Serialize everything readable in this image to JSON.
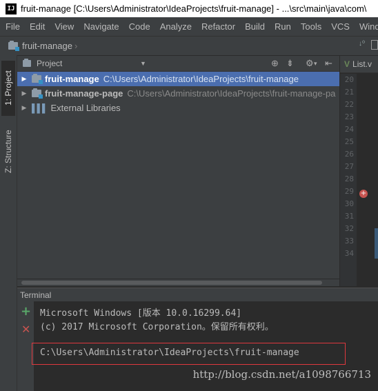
{
  "window": {
    "app_badge": "IJ",
    "title": "fruit-manage [C:\\Users\\Administrator\\IdeaProjects\\fruit-manage] - ...\\src\\main\\java\\com\\"
  },
  "menu": [
    "File",
    "Edit",
    "View",
    "Navigate",
    "Code",
    "Analyze",
    "Refactor",
    "Build",
    "Run",
    "Tools",
    "VCS",
    "Window"
  ],
  "navbar": {
    "breadcrumb": "fruit-manage"
  },
  "tool_strip": {
    "project_tab": "1: Project",
    "structure_tab": "Z: Structure"
  },
  "project_panel": {
    "header": "Project",
    "items": [
      {
        "name": "fruit-manage",
        "path": "C:\\Users\\Administrator\\IdeaProjects\\fruit-manage",
        "selected": true
      },
      {
        "name": "fruit-manage-page",
        "path": "C:\\Users\\Administrator\\IdeaProjects\\fruit-manage-pa"
      },
      {
        "name": "External Libraries",
        "path": ""
      }
    ]
  },
  "editor": {
    "tab": "List.v",
    "line_numbers": [
      "20",
      "21",
      "22",
      "23",
      "24",
      "25",
      "26",
      "27",
      "28",
      "29",
      "30",
      "31",
      "32",
      "33",
      "34"
    ]
  },
  "terminal": {
    "header": "Terminal",
    "lines": [
      "Microsoft Windows [版本 10.0.16299.64]",
      "(c) 2017 Microsoft Corporation。保留所有权利。"
    ],
    "prompt": "C:\\Users\\Administrator\\IdeaProjects\\fruit-manage"
  },
  "watermark": "http://blog.csdn.net/a1098766713",
  "colors": {
    "selection": "#4b6eaf",
    "panel": "#3c3f41",
    "editor_bg": "#2b2b2b",
    "highlight_box": "#e0383e",
    "add_icon": "#59a869",
    "close_icon": "#c75450"
  }
}
